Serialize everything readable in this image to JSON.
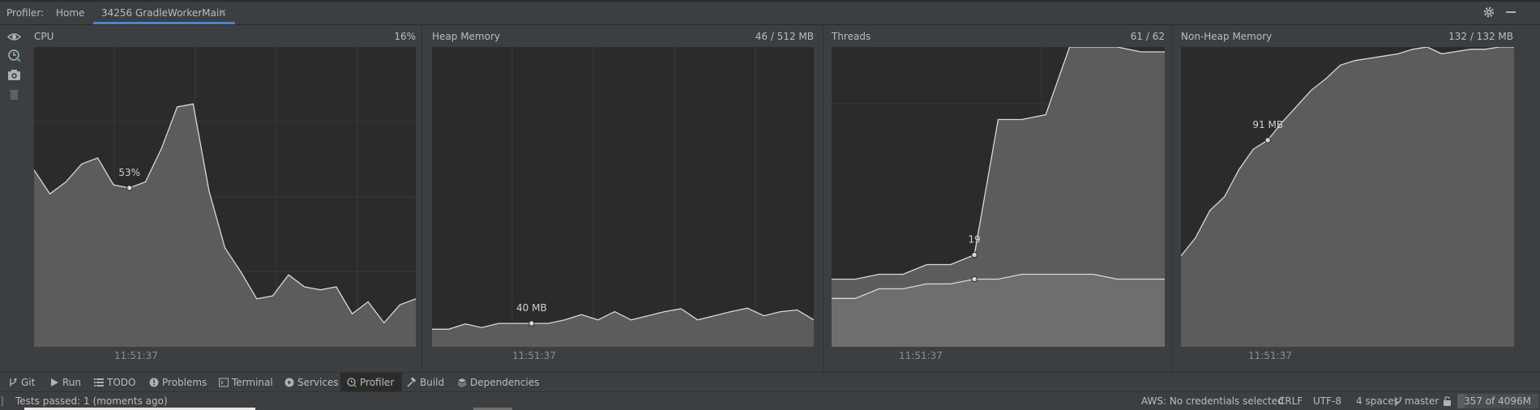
{
  "header": {
    "title": "Profiler:",
    "tabs": [
      {
        "label": "Home"
      },
      {
        "label": "34256 GradleWorkerMain"
      }
    ],
    "close_glyph": "×",
    "icons": [
      "settings-gear-icon",
      "minimize-icon"
    ]
  },
  "left_toolbar": {
    "icons": [
      "eye-icon",
      "attach-profiler-icon",
      "capture-snapshot-icon",
      "delete-icon"
    ]
  },
  "panes": {
    "cpu": {
      "title": "CPU",
      "value": "16%",
      "marker_label": "53%",
      "time": "11:51:37",
      "chart_data": {
        "type": "area",
        "title": "CPU",
        "ylim": [
          0,
          100
        ],
        "series": [
          {
            "values": [
              59,
              51,
              55,
              61,
              63,
              54,
              53,
              55,
              66,
              80,
              81,
              52,
              33,
              25,
              16,
              17,
              24,
              20,
              19,
              20,
              11,
              15,
              8,
              14,
              16
            ]
          }
        ],
        "marker": {
          "index": 6,
          "value": 53
        }
      }
    },
    "heap": {
      "title": "Heap Memory",
      "value": "46 / 512 MB",
      "marker_label": "40 MB",
      "time": "11:51:37",
      "chart_data": {
        "type": "area",
        "title": "Heap Memory",
        "ylim": [
          0,
          512
        ],
        "series": [
          {
            "values": [
              30,
              30,
              39,
              33,
              40,
              40,
              40,
              40,
              46,
              55,
              46,
              60,
              46,
              53,
              60,
              65,
              46,
              53,
              60,
              66,
              53,
              60,
              63,
              46
            ]
          }
        ],
        "marker": {
          "index": 6,
          "value": 40
        }
      }
    },
    "threads": {
      "title": "Threads",
      "value": "61 / 62",
      "marker_label": "19",
      "time": "11:51:37",
      "chart_data": {
        "type": "area",
        "title": "Threads",
        "ylim": [
          0,
          62
        ],
        "x": [
          0,
          1,
          2,
          3,
          4,
          5,
          6,
          7,
          8,
          9,
          10,
          11,
          12,
          13,
          14
        ],
        "series": [
          {
            "values": [
              14,
              14,
              15,
              15,
              17,
              17,
              19,
              47,
              47,
              48,
              62,
              62,
              62,
              61,
              61
            ]
          },
          {
            "values": [
              10,
              10,
              12,
              12,
              13,
              13,
              14,
              14,
              15,
              15,
              15,
              15,
              14,
              14,
              14
            ]
          }
        ],
        "marker": {
          "index": 6,
          "value": 19
        },
        "marker2": {
          "index": 6,
          "value": 14
        }
      }
    },
    "nonheap": {
      "title": "Non-Heap Memory",
      "value": "132 / 132 MB",
      "marker_label": "91 MB",
      "time": "11:51:37",
      "chart_data": {
        "type": "area",
        "title": "Non-Heap Memory",
        "ylim": [
          0,
          132
        ],
        "series": [
          {
            "values": [
              40,
              48,
              60,
              66,
              78,
              87,
              91,
              99,
              106,
              113,
              118,
              124,
              126,
              127,
              128,
              129,
              131,
              132,
              129,
              130,
              131,
              131,
              132,
              132
            ]
          }
        ],
        "marker": {
          "index": 6,
          "value": 91
        }
      }
    }
  },
  "toolwindows": [
    {
      "label": "Git",
      "icon": "git-branch-icon"
    },
    {
      "label": "Run",
      "icon": "run-icon"
    },
    {
      "label": "TODO",
      "icon": "todo-list-icon"
    },
    {
      "label": "Problems",
      "icon": "problems-icon"
    },
    {
      "label": "Terminal",
      "icon": "terminal-icon"
    },
    {
      "label": "Services",
      "icon": "services-icon"
    },
    {
      "label": "Profiler",
      "icon": "profiler-icon"
    },
    {
      "label": "Build",
      "icon": "build-hammer-icon"
    },
    {
      "label": "Dependencies",
      "icon": "dependencies-icon"
    }
  ],
  "status": {
    "message": "Tests passed: 1 (moments ago)",
    "aws": "AWS: No credentials selected",
    "line_sep": "CRLF",
    "encoding": "UTF-8",
    "indent": "4 spaces",
    "branch": "master",
    "memory": "357 of 4096M",
    "memory_used": 357,
    "memory_total": 4096
  },
  "colors": {
    "accent": "#4a88c7",
    "chart_bg": "#2b2b2b",
    "chart_fill": "#5c5c5c",
    "chart_line": "#d8d8d8",
    "grid": "#3a3a3a"
  }
}
